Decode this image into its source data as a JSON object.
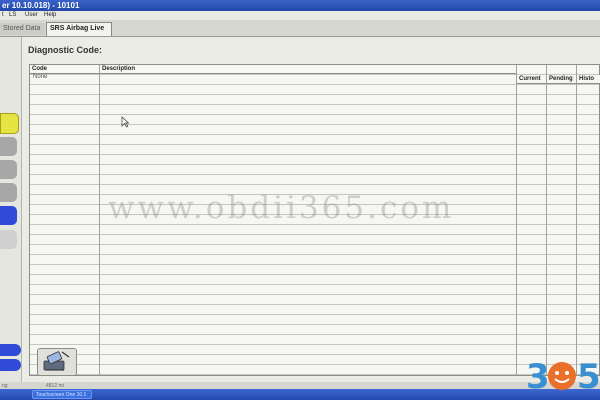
{
  "titlebar": {
    "title": "er 10.10.018) - 10101"
  },
  "menu": {
    "items": [
      "t",
      "LS",
      "User",
      "Help"
    ]
  },
  "tabs": {
    "stored": "Stored Data",
    "active": "SRS Airbag Live"
  },
  "main": {
    "section_title": "Diagnostic Code:",
    "columns": {
      "code": "Code",
      "description": "Description",
      "current": "Current",
      "pending": "Pending",
      "history": "Histo"
    },
    "rows": [
      {
        "code": "None",
        "description": ""
      }
    ]
  },
  "watermark": {
    "text": "www.obdii365.com"
  },
  "status": {
    "left": "ng",
    "mid": "4812 mi"
  },
  "taskbar": {
    "item": "Touchscreen One 10.1"
  },
  "logo": {
    "text": "365"
  },
  "colors": {
    "accent": "#2f4bd8",
    "highlight": "#e6e442",
    "logo_orange": "#e8702a",
    "logo_blue": "#3a8fd0"
  },
  "icons": {
    "tool": "eraser-icon",
    "cursor": "mouse-pointer-icon"
  }
}
